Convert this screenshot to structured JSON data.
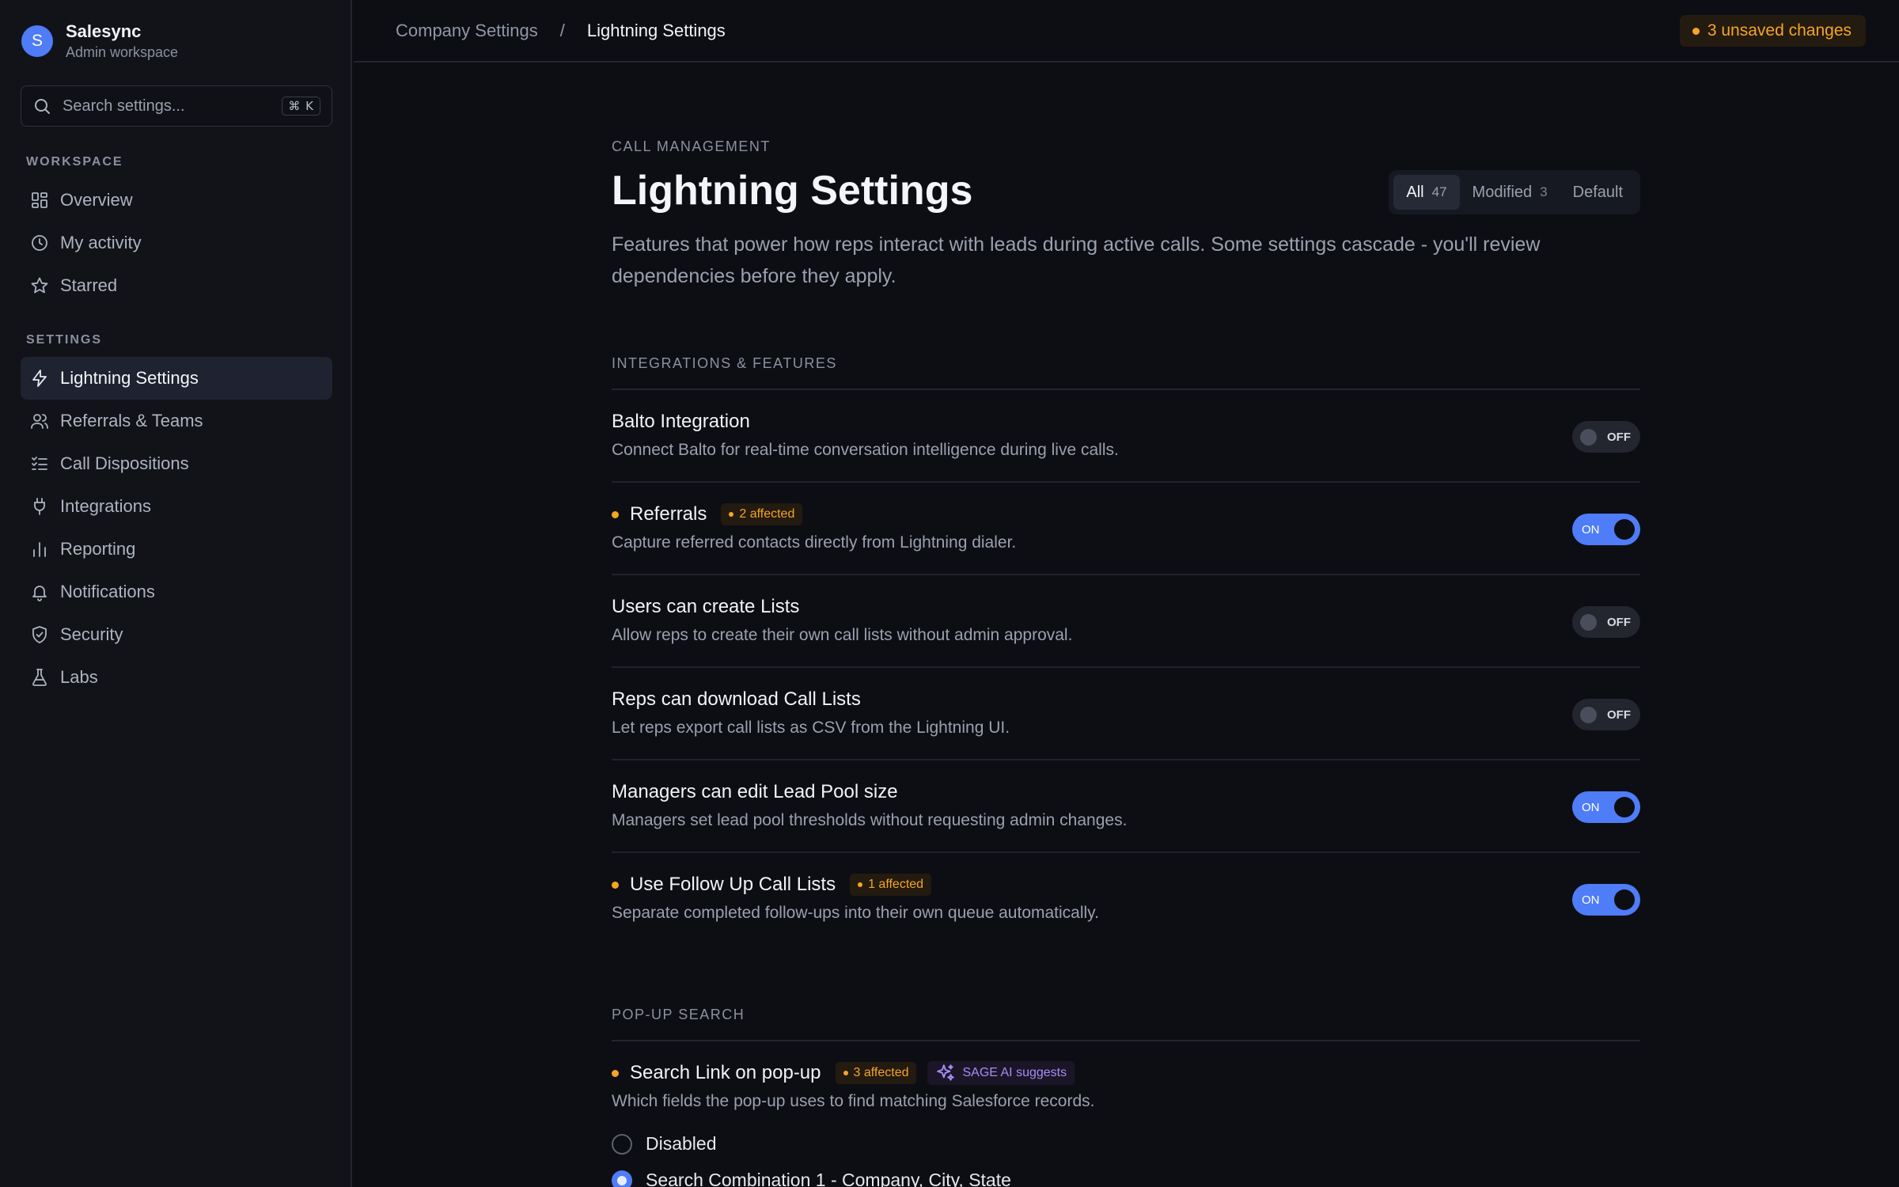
{
  "brand": {
    "initial": "S",
    "name": "Salesync",
    "subtitle": "Admin workspace"
  },
  "search": {
    "placeholder": "Search settings...",
    "shortcut": "⌘ K"
  },
  "sidebar": {
    "workspace_label": "WORKSPACE",
    "workspace_items": [
      {
        "label": "Overview",
        "icon": "grid-icon"
      },
      {
        "label": "My activity",
        "icon": "clock-icon"
      },
      {
        "label": "Starred",
        "icon": "star-icon"
      }
    ],
    "settings_label": "SETTINGS",
    "settings_items": [
      {
        "label": "Lightning Settings",
        "icon": "lightning-icon",
        "active": true
      },
      {
        "label": "Referrals & Teams",
        "icon": "users-icon"
      },
      {
        "label": "Call Dispositions",
        "icon": "checklist-icon"
      },
      {
        "label": "Integrations",
        "icon": "plug-icon"
      },
      {
        "label": "Reporting",
        "icon": "bar-chart-icon"
      },
      {
        "label": "Notifications",
        "icon": "bell-icon"
      },
      {
        "label": "Security",
        "icon": "shield-icon"
      },
      {
        "label": "Labs",
        "icon": "flask-icon"
      }
    ]
  },
  "topbar": {
    "breadcrumb_parent": "Company Settings",
    "breadcrumb_sep": "/",
    "breadcrumb_current": "Lightning Settings",
    "unsaved": "3 unsaved changes"
  },
  "page": {
    "eyebrow": "CALL MANAGEMENT",
    "title": "Lightning Settings",
    "description": "Features that power how reps interact with leads during active calls. Some settings cascade - you'll review dependencies before they apply.",
    "filters": [
      {
        "label": "All",
        "count": "47",
        "active": true
      },
      {
        "label": "Modified",
        "count": "3"
      },
      {
        "label": "Default",
        "count": ""
      }
    ]
  },
  "groups": {
    "integrations": {
      "label": "INTEGRATIONS & FEATURES",
      "settings": [
        {
          "title": "Balto Integration",
          "description": "Connect Balto for real-time conversation intelligence during live calls.",
          "modified": false,
          "affected": "",
          "state": "OFF"
        },
        {
          "title": "Referrals",
          "description": "Capture referred contacts directly from Lightning dialer.",
          "modified": true,
          "affected": "2 affected",
          "state": "ON"
        },
        {
          "title": "Users can create Lists",
          "description": "Allow reps to create their own call lists without admin approval.",
          "modified": false,
          "affected": "",
          "state": "OFF"
        },
        {
          "title": "Reps can download Call Lists",
          "description": "Let reps export call lists as CSV from the Lightning UI.",
          "modified": false,
          "affected": "",
          "state": "OFF"
        },
        {
          "title": "Managers can edit Lead Pool size",
          "description": "Managers set lead pool thresholds without requesting admin changes.",
          "modified": false,
          "affected": "",
          "state": "ON"
        },
        {
          "title": "Use Follow Up Call Lists",
          "description": "Separate completed follow-ups into their own queue automatically.",
          "modified": true,
          "affected": "1 affected",
          "state": "ON"
        }
      ]
    },
    "popup": {
      "label": "POP-UP SEARCH",
      "setting": {
        "title": "Search Link on pop-up",
        "affected": "3 affected",
        "ai_tag": "SAGE AI suggests",
        "description": "Which fields the pop-up uses to find matching Salesforce records.",
        "options": [
          {
            "label": "Disabled",
            "checked": false
          },
          {
            "label": "Search Combination 1 - Company, City, State",
            "checked": true
          }
        ]
      }
    }
  },
  "colors": {
    "accent": "#4f7cf7",
    "warning": "#f5a524",
    "ai": "#a98bf5",
    "background": "#0d0e13"
  }
}
